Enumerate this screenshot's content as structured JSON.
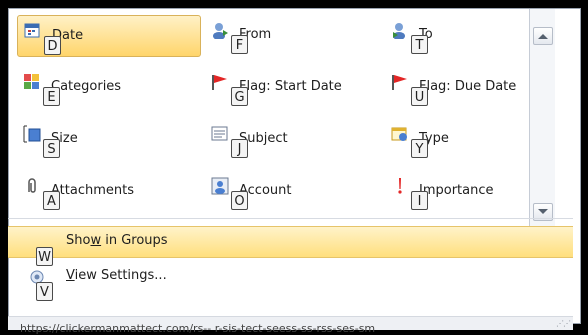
{
  "gallery": {
    "items": [
      {
        "label": "Date",
        "key": "D",
        "selected": true
      },
      {
        "label": "From",
        "key": "F"
      },
      {
        "label": "To",
        "key": "T"
      },
      {
        "label": "Categories",
        "key": "E"
      },
      {
        "label": "Flag: Start Date",
        "key": "G"
      },
      {
        "label": "Flag: Due Date",
        "key": "U"
      },
      {
        "label": "Size",
        "key": "S"
      },
      {
        "label": "Subject",
        "key": "J"
      },
      {
        "label": "Type",
        "key": "Y"
      },
      {
        "label": "Attachments",
        "key": "A"
      },
      {
        "label": "Account",
        "key": "O"
      },
      {
        "label": "Importance",
        "key": "I"
      }
    ]
  },
  "menu": {
    "show_in_groups": {
      "label": "Show in Groups",
      "key": "W"
    },
    "view_settings": {
      "label": "View Settings...",
      "key": "V"
    }
  },
  "colors": {
    "selected_bg": "#ffd56b",
    "highlight_bg": "#ffdf7d",
    "flag_red": "#e32626"
  },
  "footer": {
    "url_text": "https://clickermanmattect.com/rs-- r-sis-tect-seess-ss-rss-ses-sm"
  }
}
